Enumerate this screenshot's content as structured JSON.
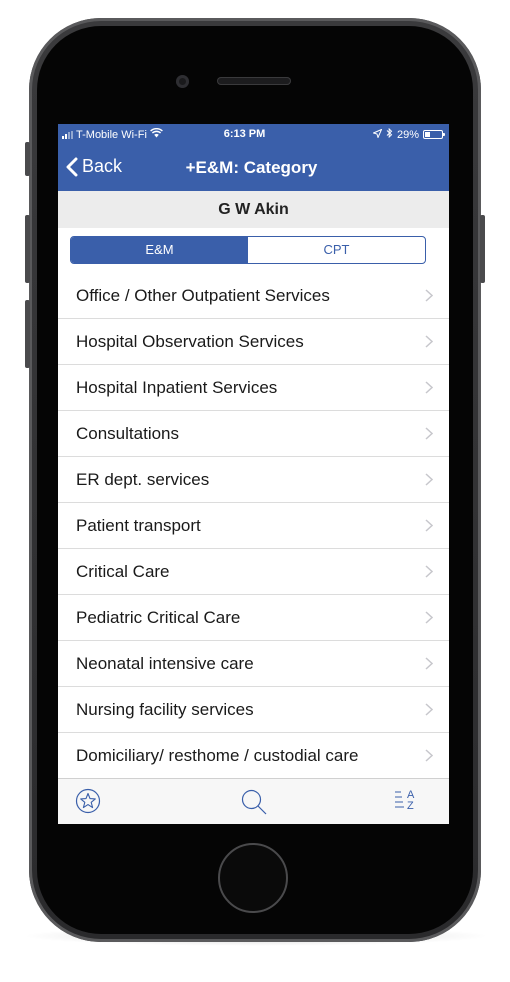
{
  "status_bar": {
    "carrier": "T-Mobile Wi-Fi",
    "time": "6:13 PM",
    "battery": "29%"
  },
  "nav": {
    "back_label": "Back",
    "title": "+E&M: Category"
  },
  "subheader": "G W Akin",
  "segments": [
    {
      "label": "E&M",
      "active": true
    },
    {
      "label": "CPT",
      "active": false
    }
  ],
  "categories": [
    {
      "label": "Office / Other Outpatient Services"
    },
    {
      "label": "Hospital Observation Services"
    },
    {
      "label": "Hospital Inpatient Services"
    },
    {
      "label": "Consultations"
    },
    {
      "label": "ER dept. services"
    },
    {
      "label": "Patient transport"
    },
    {
      "label": "Critical Care"
    },
    {
      "label": "Pediatric Critical Care"
    },
    {
      "label": "Neonatal intensive care"
    },
    {
      "label": "Nursing facility services"
    },
    {
      "label": "Domiciliary/ resthome / custodial care"
    }
  ],
  "tabbar": {
    "icons": [
      "star-icon",
      "search-icon",
      "sort-az-icon"
    ],
    "sort_letter_a": "A",
    "sort_letter_z": "Z"
  },
  "colors": {
    "accent": "#3a5faa",
    "subheader_bg": "#ececec",
    "separator": "#dcdcdc",
    "chevron": "#c7c7cc"
  }
}
